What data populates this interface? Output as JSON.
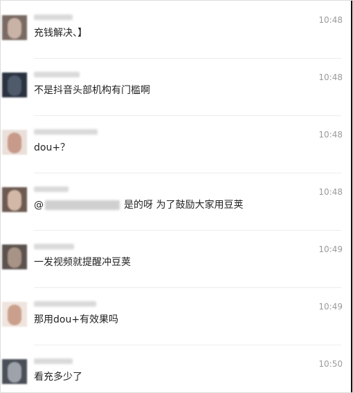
{
  "messages": [
    {
      "text": "充钱解决、】",
      "time": "10:48"
    },
    {
      "text": "不是抖音头部机构有门槛啊",
      "time": "10:48"
    },
    {
      "text": "dou+？",
      "time": "10:48"
    },
    {
      "mention_prefix": "@",
      "text": "是的呀 为了鼓励大家用豆荚",
      "time": "10:48"
    },
    {
      "text": "一发视频就提醒冲豆荚",
      "time": "10:49"
    },
    {
      "text": "那用dou+有效果吗",
      "time": "10:49"
    },
    {
      "text": "看充多少了",
      "time": "10:50"
    }
  ]
}
